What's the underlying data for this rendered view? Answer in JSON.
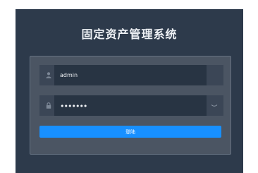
{
  "title": "固定资产管理系统",
  "username": {
    "value": "admin",
    "icon": "user-icon"
  },
  "password": {
    "masked_value": "•••••••",
    "icon": "lock-icon",
    "toggle_icon": "eye-closed-icon"
  },
  "login_button": {
    "label": "登陆"
  },
  "colors": {
    "page_bg": "#2d3a4b",
    "panel_bg": "#4b5563",
    "input_bg": "#283443",
    "button": "#1890ff"
  }
}
